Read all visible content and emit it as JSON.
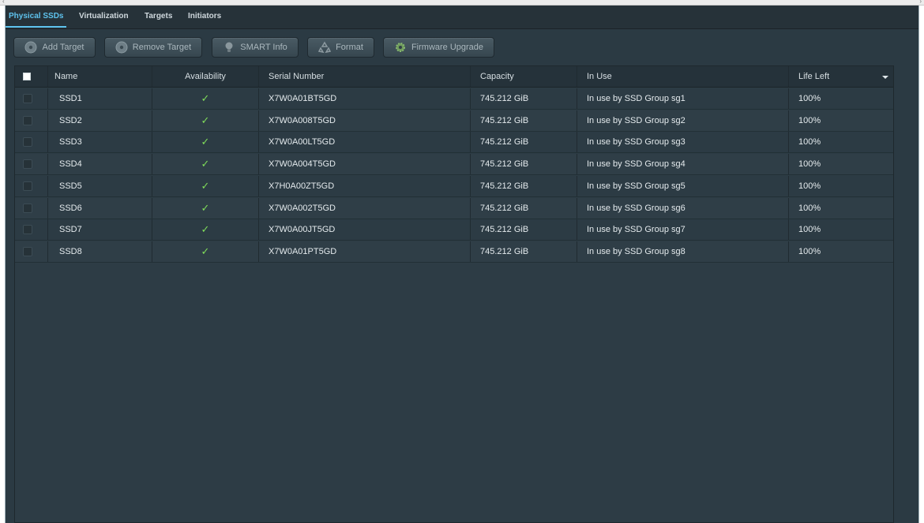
{
  "tabs": [
    {
      "label": "Physical SSDs",
      "active": true
    },
    {
      "label": "Virtualization",
      "active": false
    },
    {
      "label": "Targets",
      "active": false
    },
    {
      "label": "Initiators",
      "active": false
    }
  ],
  "toolbar": {
    "buttons": [
      {
        "label": "Add Target",
        "icon": "disc-icon"
      },
      {
        "label": "Remove Target",
        "icon": "disc-icon"
      },
      {
        "label": "SMART Info",
        "icon": "lightbulb-icon"
      },
      {
        "label": "Format",
        "icon": "recycle-icon"
      },
      {
        "label": "Firmware Upgrade",
        "icon": "gear-icon"
      }
    ]
  },
  "table": {
    "columns": [
      "Name",
      "Availability",
      "Serial Number",
      "Capacity",
      "In Use",
      "Life Left"
    ],
    "rows": [
      {
        "name": "SSD1",
        "available": "✓",
        "serial": "X7W0A01BT5GD",
        "capacity": "745.212 GiB",
        "in_use": "In use by SSD Group sg1",
        "life": "100%"
      },
      {
        "name": "SSD2",
        "available": "✓",
        "serial": "X7W0A008T5GD",
        "capacity": "745.212 GiB",
        "in_use": "In use by SSD Group sg2",
        "life": "100%"
      },
      {
        "name": "SSD3",
        "available": "✓",
        "serial": "X7W0A00LT5GD",
        "capacity": "745.212 GiB",
        "in_use": "In use by SSD Group sg3",
        "life": "100%"
      },
      {
        "name": "SSD4",
        "available": "✓",
        "serial": "X7W0A004T5GD",
        "capacity": "745.212 GiB",
        "in_use": "In use by SSD Group sg4",
        "life": "100%"
      },
      {
        "name": "SSD5",
        "available": "✓",
        "serial": "X7H0A00ZT5GD",
        "capacity": "745.212 GiB",
        "in_use": "In use by SSD Group sg5",
        "life": "100%"
      },
      {
        "name": "SSD6",
        "available": "✓",
        "serial": "X7W0A002T5GD",
        "capacity": "745.212 GiB",
        "in_use": "In use by SSD Group sg6",
        "life": "100%"
      },
      {
        "name": "SSD7",
        "available": "✓",
        "serial": "X7W0A00JT5GD",
        "capacity": "745.212 GiB",
        "in_use": "In use by SSD Group sg7",
        "life": "100%"
      },
      {
        "name": "SSD8",
        "available": "✓",
        "serial": "X7W0A01PT5GD",
        "capacity": "745.212 GiB",
        "in_use": "In use by SSD Group sg8",
        "life": "100%"
      }
    ]
  },
  "colors": {
    "accent": "#5ec3ee",
    "background": "#2b3a43",
    "check": "#7fdc5a"
  }
}
